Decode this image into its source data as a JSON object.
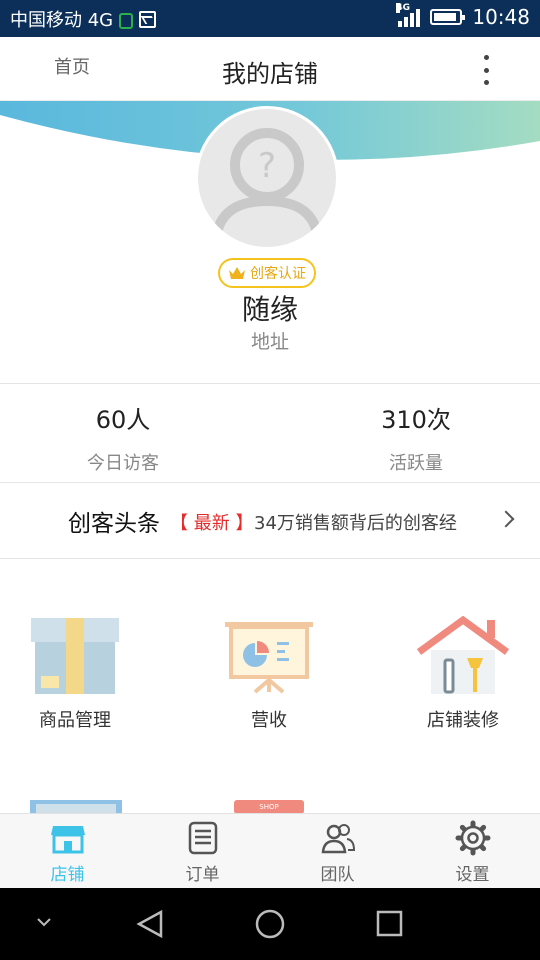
{
  "status_bar": {
    "carrier": "中国移动 4G",
    "network": "4G",
    "time": "10:48"
  },
  "header": {
    "home_label": "首页",
    "title": "我的店铺"
  },
  "profile": {
    "avatar_placeholder": "?",
    "badge_label": "创客认证",
    "name": "随缘",
    "address": "地址"
  },
  "stats": [
    {
      "value": "60人",
      "label": "今日访客"
    },
    {
      "value": "310次",
      "label": "活跃量"
    }
  ],
  "news": {
    "heading": "创客头条",
    "tag": "【 最新 】",
    "text": "34万销售额背后的创客经"
  },
  "grid": [
    {
      "label": "商品管理",
      "icon": "box-icon"
    },
    {
      "label": "营收",
      "icon": "presentation-board-icon"
    },
    {
      "label": "店铺装修",
      "icon": "house-tools-icon"
    }
  ],
  "partial_row": {
    "shop_sign": "SHOP"
  },
  "tabs": [
    {
      "label": "店铺",
      "icon": "store-icon",
      "active": true
    },
    {
      "label": "订单",
      "icon": "order-list-icon",
      "active": false
    },
    {
      "label": "团队",
      "icon": "team-icon",
      "active": false
    },
    {
      "label": "设置",
      "icon": "gear-icon",
      "active": false
    }
  ],
  "colors": {
    "status_bar": "#0c2f59",
    "accent": "#3ec3e8",
    "badge": "#f4c31c",
    "news_tag": "#e52c2c"
  }
}
